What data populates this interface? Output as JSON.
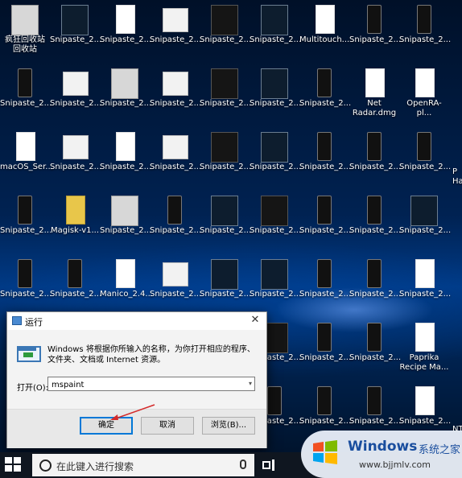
{
  "desktop": {
    "rows": [
      [
        {
          "label": "疯狂回收站\n回收站",
          "thumb": "gray"
        },
        {
          "label": "Snipaste_2...",
          "thumb": "screen"
        },
        {
          "label": "Snipaste_2...",
          "thumb": "white"
        },
        {
          "label": "Snipaste_2...",
          "thumb": "doc"
        },
        {
          "label": "Snipaste_2...",
          "thumb": "dark"
        },
        {
          "label": "Snipaste_2...",
          "thumb": "screen"
        },
        {
          "label": "Multitouch...",
          "thumb": "white"
        },
        {
          "label": "Snipaste_2...",
          "thumb": "phone"
        },
        {
          "label": "Snipaste_2...",
          "thumb": "phone"
        }
      ],
      [
        {
          "label": "Snipaste_2...",
          "thumb": "phone"
        },
        {
          "label": "Snipaste_2...",
          "thumb": "doc"
        },
        {
          "label": "Snipaste_2...",
          "thumb": "gray"
        },
        {
          "label": "Snipaste_2...",
          "thumb": "doc"
        },
        {
          "label": "Snipaste_2...",
          "thumb": "dark"
        },
        {
          "label": "Snipaste_2...",
          "thumb": "screen"
        },
        {
          "label": "Snipaste_2...",
          "thumb": "phone"
        },
        {
          "label": "Net Radar.dmg",
          "thumb": "white"
        },
        {
          "label": "OpenRA-pl...",
          "thumb": "white"
        }
      ],
      [
        {
          "label": "macOS_Ser...",
          "thumb": "white"
        },
        {
          "label": "Snipaste_2...",
          "thumb": "doc"
        },
        {
          "label": "Snipaste_2...",
          "thumb": "white"
        },
        {
          "label": "Snipaste_2...",
          "thumb": "doc"
        },
        {
          "label": "Snipaste_2...",
          "thumb": "dark"
        },
        {
          "label": "Snipaste_2...",
          "thumb": "screen"
        },
        {
          "label": "Snipaste_2...",
          "thumb": "phone"
        },
        {
          "label": "Snipaste_2...",
          "thumb": "phone"
        },
        {
          "label": "Snipaste_2...",
          "thumb": "phone"
        }
      ],
      [
        {
          "label": "Snipaste_2...",
          "thumb": "phone"
        },
        {
          "label": "Magisk-v1...",
          "thumb": "zip"
        },
        {
          "label": "Snipaste_2...",
          "thumb": "gray"
        },
        {
          "label": "Snipaste_2...",
          "thumb": "phone"
        },
        {
          "label": "Snipaste_2...",
          "thumb": "screen"
        },
        {
          "label": "Snipaste_2...",
          "thumb": "dark"
        },
        {
          "label": "Snipaste_2...",
          "thumb": "phone"
        },
        {
          "label": "Snipaste_2...",
          "thumb": "phone"
        },
        {
          "label": "Snipaste_2...",
          "thumb": "screen"
        }
      ],
      [
        {
          "label": "Snipaste_2...",
          "thumb": "phone"
        },
        {
          "label": "Snipaste_2...",
          "thumb": "phone"
        },
        {
          "label": "Manico_2.4...",
          "thumb": "white"
        },
        {
          "label": "Snipaste_2...",
          "thumb": "doc"
        },
        {
          "label": "Snipaste_2...",
          "thumb": "screen"
        },
        {
          "label": "Snipaste_2...",
          "thumb": "screen"
        },
        {
          "label": "Snipaste_2...",
          "thumb": "phone"
        },
        {
          "label": "Snipaste_2...",
          "thumb": "phone"
        },
        {
          "label": "Snipaste_2...",
          "thumb": "white"
        }
      ]
    ],
    "right_column": [
      {
        "label": "Snipaste_2...",
        "thumb": "dark"
      },
      {
        "label": "Snipaste_2...",
        "thumb": "phone"
      },
      {
        "label": "Snipaste_2...",
        "thumb": "phone"
      },
      {
        "label": "Paprika Recipe Ma...",
        "thumb": "white"
      },
      {
        "label": "Snipaste_2...",
        "thumb": "phone"
      },
      {
        "label": "Snipaste_2...",
        "thumb": "phone"
      },
      {
        "label": "Snipaste_2...",
        "thumb": "phone"
      },
      {
        "label": "Snipaste_2...",
        "thumb": "white"
      }
    ],
    "edge_labels": [
      "P",
      "Ha",
      "NT"
    ]
  },
  "run_dialog": {
    "title": "运行",
    "close": "✕",
    "description": "Windows 将根据你所输入的名称，为你打开相应的程序、文件夹、文档或 Internet 资源。",
    "open_label": "打开(O):",
    "input_value": "mspaint",
    "dropdown": "▾",
    "ok_label": "确定",
    "cancel_label": "取消",
    "browse_label": "浏览(B)..."
  },
  "taskbar": {
    "search_placeholder": "在此键入进行搜索"
  },
  "watermark": {
    "title": "Windows",
    "chinese": "系统之家",
    "url": "www.bjjmlv.com"
  },
  "colors": {
    "accent": "#0078d7",
    "arrow": "#d42a2a"
  }
}
